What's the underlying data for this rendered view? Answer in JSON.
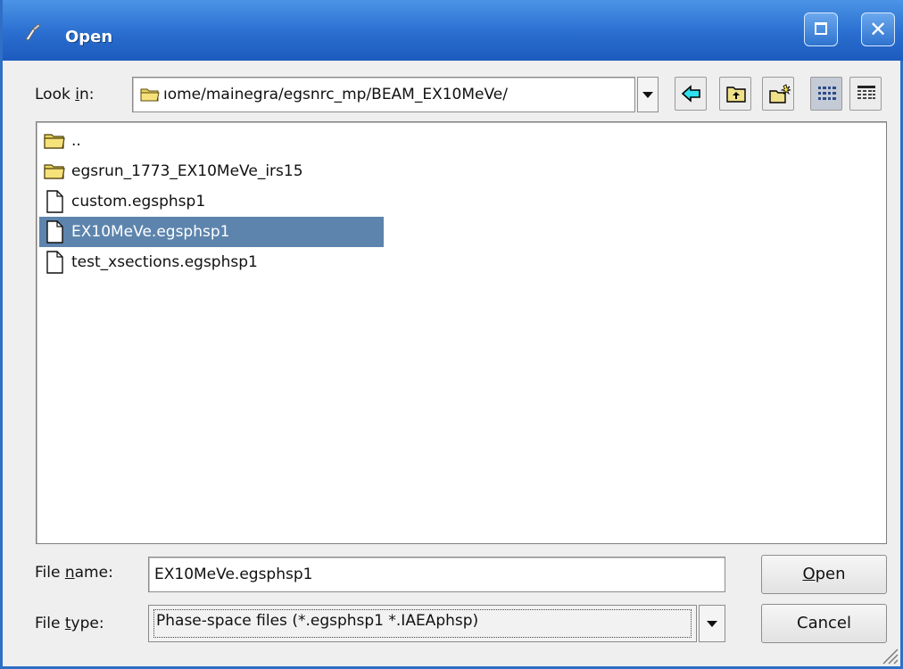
{
  "window": {
    "title": "Open"
  },
  "lookin": {
    "label_pre": "Look ",
    "label_mn": "i",
    "label_post": "n:",
    "path": "ıome/mainegra/egsnrc_mp/BEAM_EX10MeVe/"
  },
  "toolbar": {
    "buttons": [
      "back-icon",
      "up-folder-icon",
      "new-folder-icon",
      "list-view-icon",
      "details-view-icon"
    ]
  },
  "files": {
    "items": [
      {
        "name": "..",
        "type": "folder"
      },
      {
        "name": "egsrun_1773_EX10MeVe_irs15",
        "type": "folder"
      },
      {
        "name": "custom.egsphsp1",
        "type": "file"
      },
      {
        "name": "EX10MeVe.egsphsp1",
        "type": "file",
        "selected": true
      },
      {
        "name": "test_xsections.egsphsp1",
        "type": "file"
      }
    ]
  },
  "filename": {
    "label_pre": "File ",
    "label_mn": "n",
    "label_post": "ame:",
    "value": "EX10MeVe.egsphsp1"
  },
  "filetype": {
    "label_pre": "File ",
    "label_mn": "t",
    "label_post": "ype:",
    "value": "Phase-space files (*.egsphsp1 *.IAEAphsp)"
  },
  "buttons": {
    "open_mn": "O",
    "open_rest": "pen",
    "cancel": "Cancel"
  },
  "colors": {
    "titlebar": "#2a6ed0",
    "selection": "#5d84ad",
    "dialog_bg": "#efefef"
  }
}
